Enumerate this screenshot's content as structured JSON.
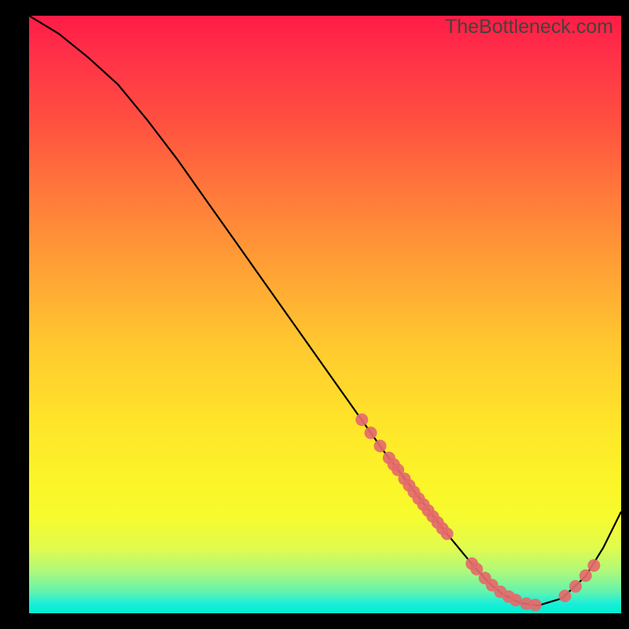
{
  "watermark": "TheBottleneck.com",
  "colors": {
    "curve_stroke": "#000000",
    "dot_fill": "#e46a6b",
    "background": "#000000"
  },
  "chart_data": {
    "type": "line",
    "title": "",
    "xlabel": "",
    "ylabel": "",
    "xlim": [
      0,
      100
    ],
    "ylim": [
      0,
      100
    ],
    "curve": {
      "x": [
        0,
        5,
        10,
        15,
        20,
        25,
        30,
        35,
        40,
        45,
        50,
        55,
        60,
        65,
        70,
        75,
        78,
        80,
        83,
        86,
        90,
        94,
        97,
        100
      ],
      "y": [
        100,
        97,
        93,
        88.5,
        82.5,
        76,
        69,
        62,
        55,
        48,
        41,
        34,
        27,
        20.5,
        14,
        8,
        4.8,
        3.2,
        1.7,
        1.3,
        2.5,
        6.2,
        11,
        17
      ]
    },
    "series": [
      {
        "name": "dot_cluster_upper",
        "x": [
          56.2,
          57.7,
          59.3,
          60.8,
          61.6,
          62.3,
          63.4,
          64.2,
          65.0,
          65.8,
          66.6,
          67.4,
          68.2,
          69.0,
          69.8,
          70.6
        ],
        "y": [
          32.4,
          30.2,
          28.0,
          26.0,
          24.9,
          24.0,
          22.5,
          21.4,
          20.3,
          19.2,
          18.2,
          17.2,
          16.2,
          15.2,
          14.2,
          13.3
        ]
      },
      {
        "name": "dot_cluster_bottom",
        "x": [
          74.8,
          75.6,
          77.0,
          78.2,
          79.6,
          81.0,
          82.2,
          84.0,
          85.5
        ],
        "y": [
          8.3,
          7.4,
          5.9,
          4.7,
          3.6,
          2.8,
          2.2,
          1.6,
          1.4
        ]
      },
      {
        "name": "dot_cluster_right",
        "x": [
          90.5,
          92.3,
          94.0,
          95.4
        ],
        "y": [
          2.9,
          4.5,
          6.3,
          8.0
        ]
      }
    ]
  }
}
